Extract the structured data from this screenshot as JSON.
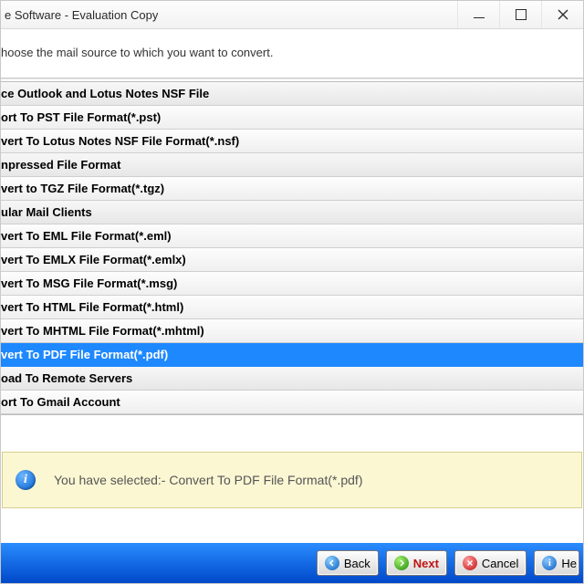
{
  "title": "e Software - Evaluation Copy",
  "instruction": "hoose the mail source to which you want to convert.",
  "groups": [
    {
      "header": "ce Outlook and Lotus Notes NSF File",
      "items": [
        "ort To PST File Format(*.pst)",
        "vert To Lotus Notes NSF File Format(*.nsf)"
      ]
    },
    {
      "header": "npressed File Format",
      "items": [
        "vert to TGZ File Format(*.tgz)"
      ]
    },
    {
      "header": "ular Mail Clients",
      "items": [
        "vert To EML File Format(*.eml)",
        "vert To EMLX File Format(*.emlx)",
        "vert To MSG File Format(*.msg)",
        "vert To HTML File Format(*.html)",
        "vert To MHTML File Format(*.mhtml)",
        "vert To PDF File Format(*.pdf)"
      ]
    },
    {
      "header": "oad To Remote Servers",
      "items": [
        "ort To Gmail Account"
      ]
    }
  ],
  "selected_text": "vert To PDF File Format(*.pdf)",
  "info_label": "You have selected:- Convert To PDF File Format(*.pdf)",
  "footer": {
    "back": "Back",
    "next": "Next",
    "cancel": "Cancel",
    "help": "He"
  }
}
